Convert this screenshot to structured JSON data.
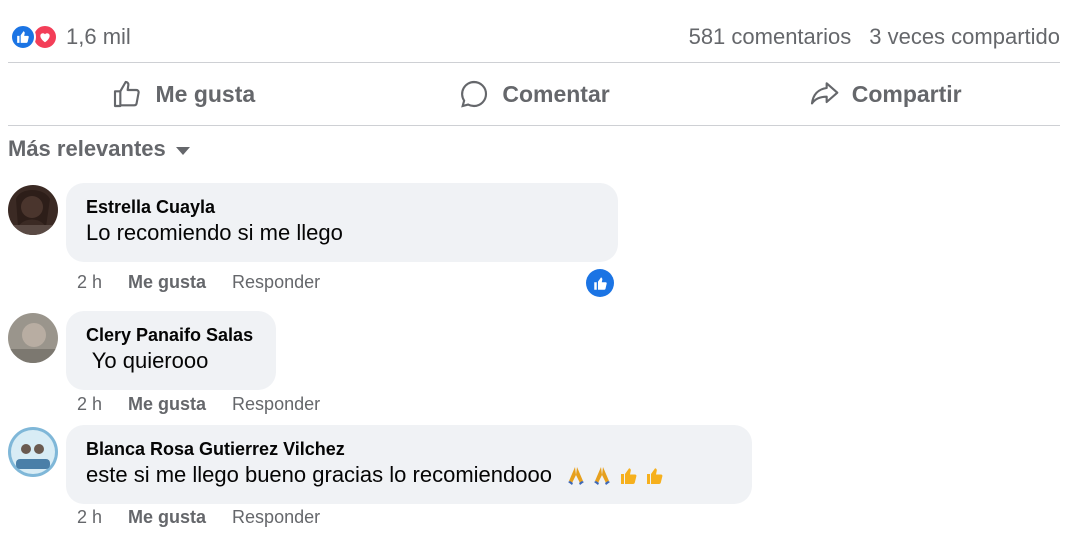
{
  "summary": {
    "reaction_count": "1,6 mil",
    "comments": "581 comentarios",
    "shares": "3 veces compartido"
  },
  "actions": {
    "like": "Me gusta",
    "comment": "Comentar",
    "share": "Compartir"
  },
  "sort": {
    "label": "Más relevantes"
  },
  "comments": [
    {
      "author": "Estrella Cuayla",
      "text": "Lo recomiendo si me llego",
      "time": "2 h",
      "like": "Me gusta",
      "reply": "Responder"
    },
    {
      "author": "Clery Panaifo Salas",
      "text": " Yo quierooo",
      "time": "2 h",
      "like": "Me gusta",
      "reply": "Responder"
    },
    {
      "author": "Blanca Rosa Gutierrez Vilchez",
      "text": "este si me llego bueno gracias lo recomiendooo",
      "time": "2 h",
      "like": "Me gusta",
      "reply": "Responder",
      "emoji": [
        "folded-hands-icon",
        "folded-hands-icon",
        "thumbs-up-emoji-icon",
        "thumbs-up-emoji-icon"
      ]
    }
  ],
  "colors": {
    "accent": "#1b74e4",
    "love": "#f33e58",
    "secondary_text": "#65676b",
    "bubble": "#f0f2f5"
  }
}
